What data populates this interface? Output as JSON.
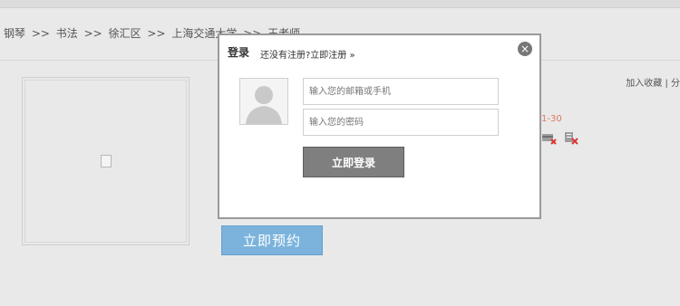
{
  "breadcrumb": [
    "钢琴",
    ">>",
    "书法",
    ">>",
    "徐汇区",
    ">>",
    "上海交通大学",
    ">>",
    "王老师"
  ],
  "header_links": "加入收藏 | 分",
  "sessions": "1-30",
  "book_button": "立即预约",
  "modal": {
    "title": "登录",
    "register_text": "还没有注册?立即注册 »",
    "email_placeholder": "输入您的邮箱或手机",
    "password_placeholder": "输入您的密码",
    "login_button": "立即登录",
    "close_icon": "×"
  },
  "icons": [
    "close-circle-icon",
    "avatar-placeholder-icon",
    "card-x-icon",
    "doc-x-icon",
    "broken-image-icon"
  ]
}
